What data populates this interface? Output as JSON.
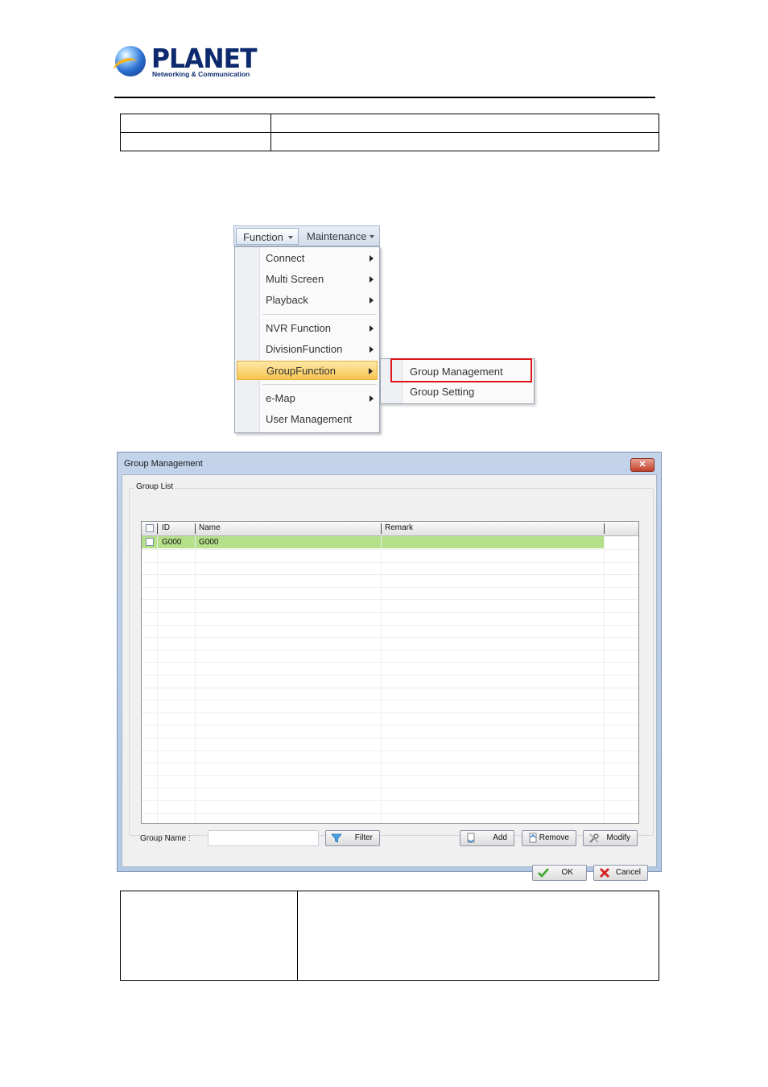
{
  "header": {
    "brand": "PLANET",
    "tagline": "Networking & Communication"
  },
  "menu": {
    "menubar": [
      "Function",
      "Maintenance"
    ],
    "items": [
      {
        "label": "Connect",
        "submenu": true
      },
      {
        "label": "Multi Screen",
        "submenu": true
      },
      {
        "label": "Playback",
        "submenu": true
      },
      {
        "label": "NVR Function",
        "submenu": true
      },
      {
        "label": "DivisionFunction",
        "submenu": true
      },
      {
        "label": "GroupFunction",
        "submenu": true,
        "highlighted": true
      },
      {
        "label": "e-Map",
        "submenu": true
      },
      {
        "label": "User Management",
        "submenu": false
      }
    ],
    "submenu_items": [
      "Group Management",
      "Group Setting"
    ],
    "highlight_color": "#e0141b"
  },
  "dialog": {
    "title": "Group Management",
    "close_glyph": "✕",
    "group_label": "Group List",
    "columns": [
      "ID",
      "Name",
      "Remark"
    ],
    "rows": [
      {
        "id": "G000",
        "name": "G000",
        "remark": ""
      }
    ],
    "group_name_label": "Group Name :",
    "group_name_value": "",
    "buttons": {
      "filter": "Filter",
      "add": "Add",
      "remove": "Remove",
      "modify": "Modify",
      "ok": "OK",
      "cancel": "Cancel"
    },
    "row_color": "#b5e08a"
  }
}
